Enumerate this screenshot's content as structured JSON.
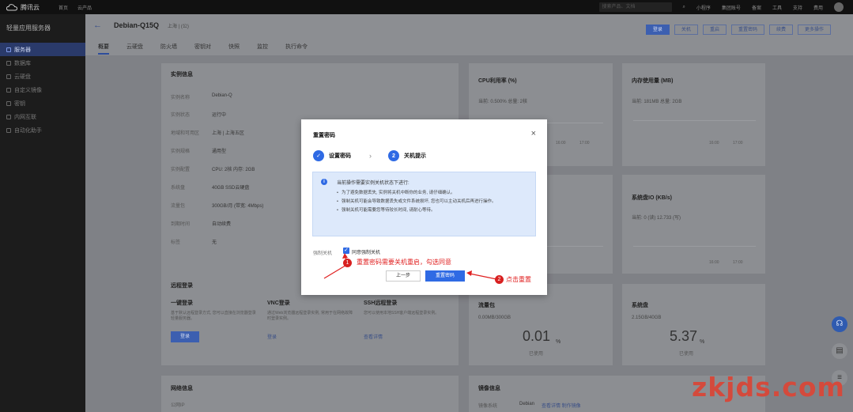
{
  "topbar": {
    "logo": "腾讯云",
    "nav_home": "首页",
    "nav_products": "云产品",
    "search_placeholder": "搜索产品、文档",
    "mini_program": "小程序",
    "cloud_account": "集团账号",
    "filing": "备案",
    "tools": "工具",
    "support": "支持",
    "cost": "费用"
  },
  "sidebar": {
    "title": "轻量应用服务器",
    "items": [
      {
        "label": "服务器",
        "active": true
      },
      {
        "label": "数据库",
        "active": false
      },
      {
        "label": "云硬盘",
        "active": false
      },
      {
        "label": "自定义镜像",
        "active": false
      },
      {
        "label": "密钥",
        "active": false
      },
      {
        "label": "内网互联",
        "active": false
      },
      {
        "label": "自动化助手",
        "active": false
      }
    ]
  },
  "header": {
    "back": "←",
    "instance_name": "Debian-Q15Q",
    "meta": "上海 | (公)",
    "buttons": [
      "登录",
      "关机",
      "重启",
      "重置密码",
      "续费",
      "更多操作"
    ]
  },
  "tabs": [
    "概要",
    "云硬盘",
    "防火墙",
    "密钥对",
    "快照",
    "监控",
    "执行命令"
  ],
  "instance_info": {
    "title": "实例信息",
    "rows": [
      {
        "label": "实例名称",
        "value": "Debian-Q"
      },
      {
        "label": "实例状态",
        "value": "运行中"
      },
      {
        "label": "地域和可用区",
        "value": "上海 | 上海五区"
      },
      {
        "label": "实例规格",
        "value": "通用型"
      },
      {
        "label": "实例配置",
        "value": "CPU: 2核 内存: 2GB"
      },
      {
        "label": "系统盘",
        "value": "40GB SSD云硬盘"
      },
      {
        "label": "流量包",
        "value": "300GB/月 (带宽: 4Mbps)"
      },
      {
        "label": "到期时间",
        "value": "自动续费"
      },
      {
        "label": "标签",
        "value": "无"
      }
    ]
  },
  "cpu_card": {
    "title": "CPU利用率 (%)",
    "sub": "当前: 0.500%  总量: 2核",
    "times": [
      "16:00",
      "17:00"
    ]
  },
  "mem_card": {
    "title": "内存使用量 (MB)",
    "sub": "当前: 181MB  总量: 2GB",
    "times": [
      "16:00",
      "17:00"
    ]
  },
  "disk_card": {
    "title": "系统盘IO (KB/s)",
    "sub": "当前: 0 (读) 12.733 (写)",
    "times": [
      "16:00",
      "17:00"
    ]
  },
  "remote_login": {
    "title": "远程登录",
    "one_click": {
      "title": "一键登录",
      "desc": "基于默认远程登录方式, 您可以直接在浏览器登录轻量服务器。",
      "button": "登录"
    },
    "vnc": {
      "title": "VNC登录",
      "desc": "通过Web浏览器远程登录实例, 常用于在网络故障时登录实例。",
      "link": "登录"
    },
    "ssh": {
      "title": "SSH远程登录",
      "desc": "您可以使用本地SSH客户端远程登录实例。",
      "link": "查看详情"
    }
  },
  "traffic_card": {
    "title": "流量包",
    "sub": "0.00MB/300GB",
    "value": "0.01",
    "unit": "%",
    "used_label": "已使用"
  },
  "sysdisk_card": {
    "title": "系统盘",
    "sub": "2.15GB/40GB",
    "value": "5.37",
    "unit": "%",
    "used_label": "已使用"
  },
  "network_info": {
    "title": "网络信息",
    "label": "公网IP"
  },
  "image_info": {
    "title": "镜像信息",
    "label": "镜像系统",
    "os": "Debian",
    "links": "查看详情 制作镜像"
  },
  "modal": {
    "title": "重置密码",
    "close": "×",
    "step1": {
      "num": "✓",
      "label": "设置密码"
    },
    "step2": {
      "num": "2",
      "label": "关机提示"
    },
    "arrow": "›",
    "notice_icon": "i",
    "notice_lead": "当前操作需要实例关机状态下进行:",
    "notice_items": [
      "为了避免数据丢失, 实例将关机中断你的业务, 请仔细确认。",
      "强制关机可能会导致数据丢失或文件系统损坏, 您也可以主动关机后再进行操作。",
      "强制关机可能需要您等待较长时间, 请耐心等待。"
    ],
    "force_label": "强制关机",
    "checkbox_check": "✓",
    "checkbox_label": "同意强制关机",
    "prev_button": "上一步",
    "reset_button": "重置密码"
  },
  "annotations": {
    "badge1": "1",
    "note1": "重置密码需要关机重启，勾选同意",
    "badge2": "2",
    "note2": "点击重置"
  },
  "watermark": "zkjds.com",
  "float_icons": [
    "headset-icon",
    "book-icon",
    "list-icon"
  ]
}
